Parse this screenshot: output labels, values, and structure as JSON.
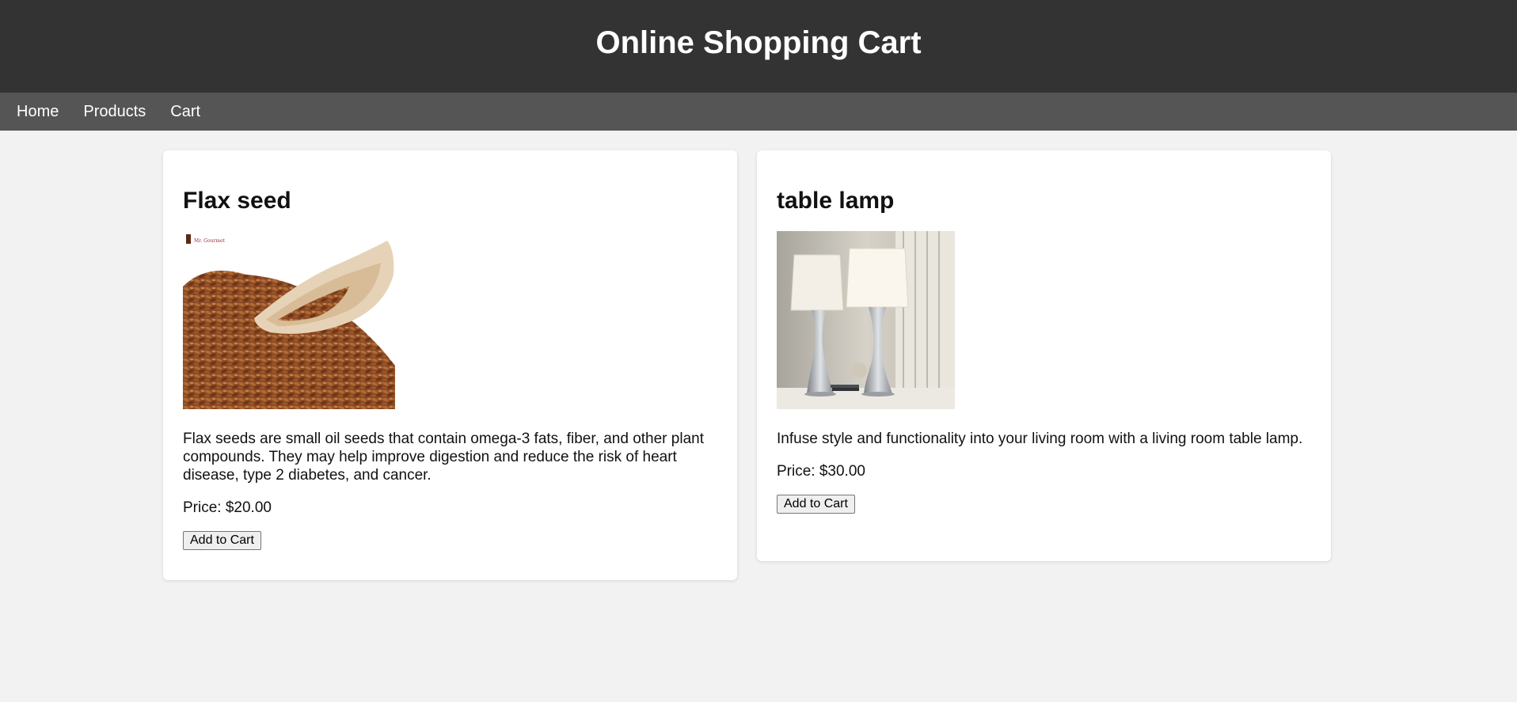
{
  "header": {
    "title": "Online Shopping Cart"
  },
  "nav": {
    "items": [
      {
        "label": "Home"
      },
      {
        "label": "Products"
      },
      {
        "label": "Cart"
      }
    ]
  },
  "products": [
    {
      "name": "Flax seed",
      "description": "Flax seeds are small oil seeds that contain omega-3 fats, fiber, and other plant compounds. They may help improve digestion and reduce the risk of heart disease, type 2 diabetes, and cancer.",
      "price": "Price: $20.00",
      "button_label": "Add to Cart"
    },
    {
      "name": "table lamp",
      "description": "Infuse style and functionality into your living room with a living room table lamp.",
      "price": "Price: $30.00",
      "button_label": "Add to Cart"
    }
  ],
  "colors": {
    "header_bg": "#333333",
    "nav_bg": "#555555",
    "page_bg": "#f2f2f2",
    "card_bg": "#ffffff"
  }
}
